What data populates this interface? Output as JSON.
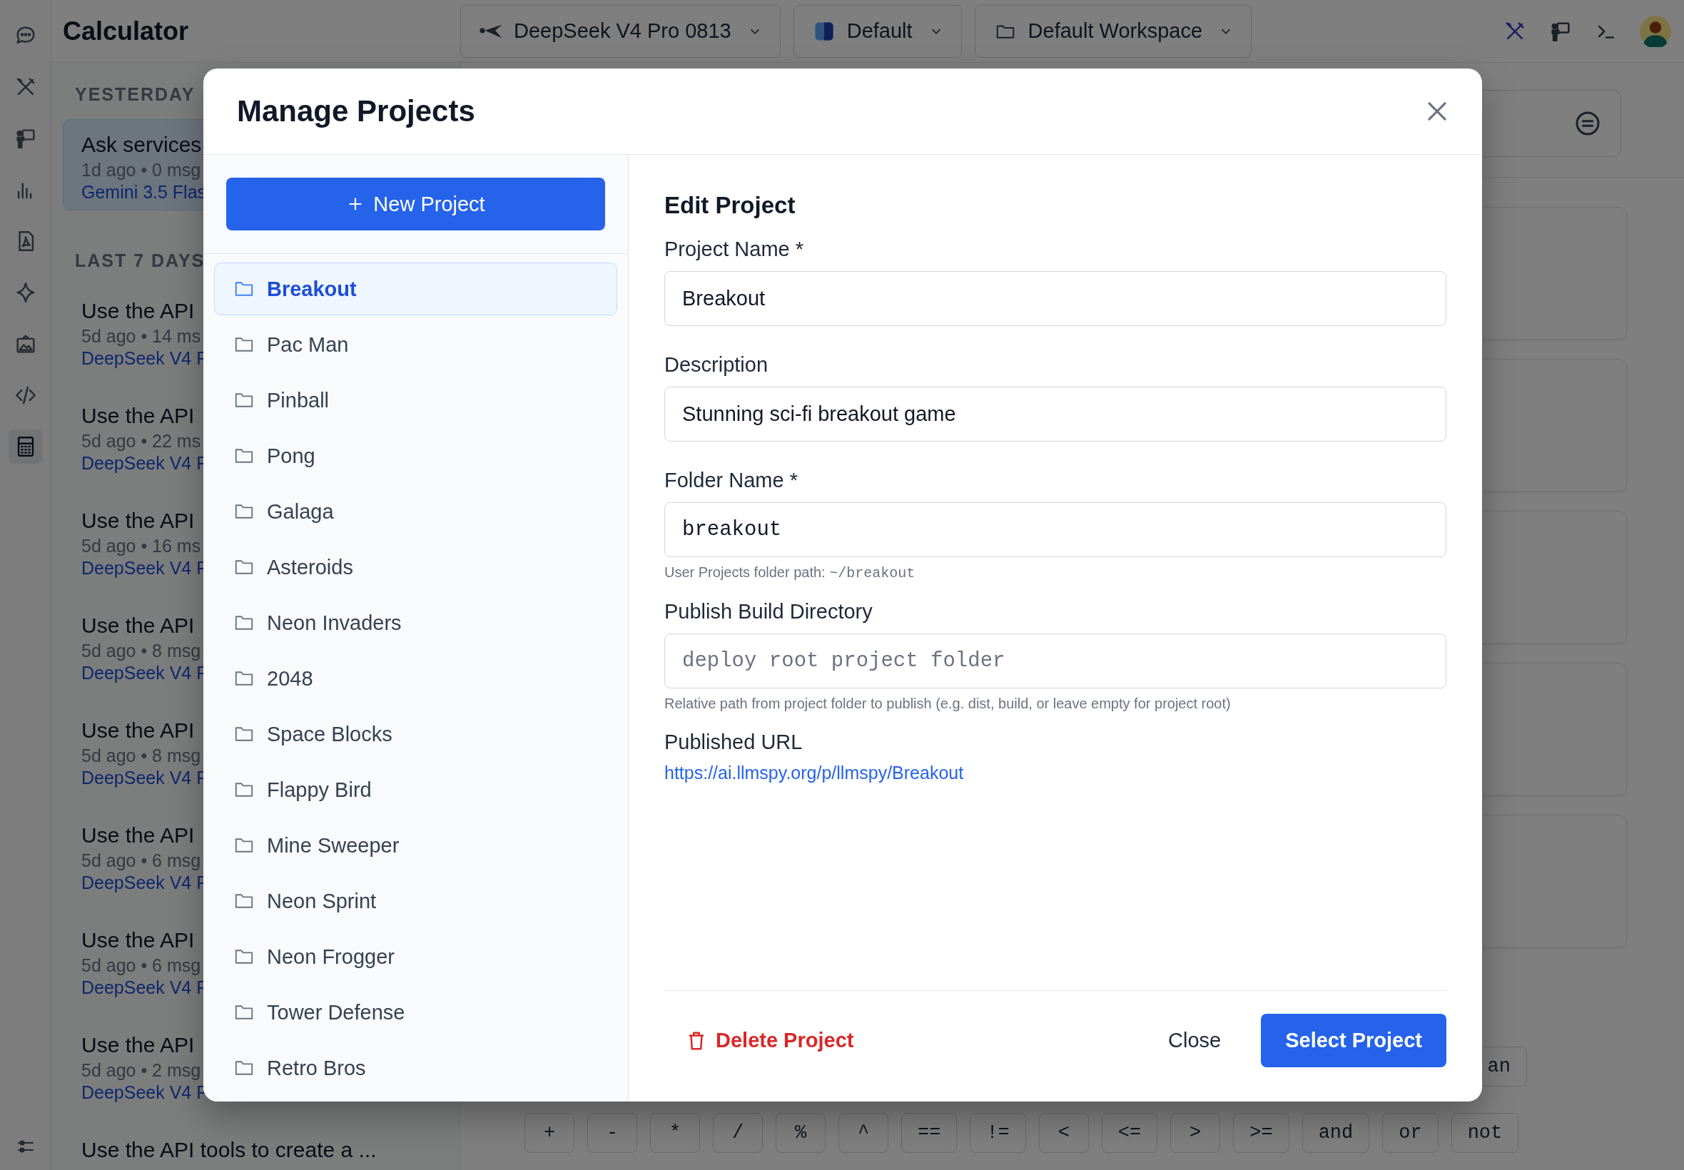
{
  "app": {
    "title": "Calculator"
  },
  "toolbar": {
    "model": "DeepSeek V4 Pro 0813",
    "profile": "Default",
    "workspace": "Default Workspace"
  },
  "rail": [
    {
      "kind": "chat",
      "selected": false
    },
    {
      "kind": "tools",
      "selected": false
    },
    {
      "kind": "presenter",
      "selected": false
    },
    {
      "kind": "chart",
      "selected": false
    },
    {
      "kind": "pdf",
      "selected": false
    },
    {
      "kind": "sparkle",
      "selected": false
    },
    {
      "kind": "image",
      "selected": false
    },
    {
      "kind": "code",
      "selected": false
    },
    {
      "kind": "calculator",
      "selected": true
    }
  ],
  "history": [
    {
      "heading": "YESTERDAY",
      "items": [
        {
          "title": "Ask services",
          "meta": "1d ago • 0 msg",
          "model": "Gemini 3.5 Flas",
          "selected": true
        }
      ]
    },
    {
      "heading": "LAST 7 DAYS",
      "items": [
        {
          "title": "Use the API",
          "meta": "5d ago • 14 ms",
          "model": "DeepSeek V4 F",
          "selected": false
        },
        {
          "title": "Use the API",
          "meta": "5d ago • 22 ms",
          "model": "DeepSeek V4 F",
          "selected": false
        },
        {
          "title": "Use the API",
          "meta": "5d ago • 16 ms",
          "model": "DeepSeek V4 F",
          "selected": false
        },
        {
          "title": "Use the API",
          "meta": "5d ago • 8 msg",
          "model": "DeepSeek V4 F",
          "selected": false
        },
        {
          "title": "Use the API",
          "meta": "5d ago • 8 msg",
          "model": "DeepSeek V4 F",
          "selected": false
        },
        {
          "title": "Use the API",
          "meta": "5d ago • 6 msg",
          "model": "DeepSeek V4 F",
          "selected": false
        },
        {
          "title": "Use the API",
          "meta": "5d ago • 6 msg",
          "model": "DeepSeek V4 F",
          "selected": false
        },
        {
          "title": "Use the API",
          "meta": "5d ago • 2 msg",
          "model": "DeepSeek V4 F",
          "selected": false
        },
        {
          "title": "Use the API tools to create a ...",
          "selected": false
        }
      ]
    }
  ],
  "partial_key": "an",
  "operators": [
    "+",
    "-",
    "*",
    "/",
    "%",
    "^",
    "==",
    "!=",
    "<",
    "<=",
    ">",
    ">=",
    "and",
    "or",
    "not"
  ],
  "modal": {
    "title": "Manage Projects",
    "new_project_button": "New Project",
    "projects": [
      {
        "name": "Breakout",
        "selected": true
      },
      {
        "name": "Pac Man",
        "selected": false
      },
      {
        "name": "Pinball",
        "selected": false
      },
      {
        "name": "Pong",
        "selected": false
      },
      {
        "name": "Galaga",
        "selected": false
      },
      {
        "name": "Asteroids",
        "selected": false
      },
      {
        "name": "Neon Invaders",
        "selected": false
      },
      {
        "name": "2048",
        "selected": false
      },
      {
        "name": "Space Blocks",
        "selected": false
      },
      {
        "name": "Flappy Bird",
        "selected": false
      },
      {
        "name": "Mine Sweeper",
        "selected": false
      },
      {
        "name": "Neon Sprint",
        "selected": false
      },
      {
        "name": "Neon Frogger",
        "selected": false
      },
      {
        "name": "Tower Defense",
        "selected": false
      },
      {
        "name": "Retro Bros",
        "selected": false
      }
    ],
    "form": {
      "heading": "Edit Project",
      "fields": [
        {
          "label": "Project Name *",
          "value": "Breakout",
          "mono": false
        },
        {
          "label": "Description",
          "value": "Stunning sci-fi breakout game",
          "mono": false
        },
        {
          "label": "Folder Name *",
          "value": "breakout",
          "mono": true,
          "hint": "User Projects folder path: ",
          "hint_path": "~/breakout"
        },
        {
          "label": "Publish Build Directory",
          "placeholder": "deploy root project folder",
          "mono": true,
          "hint": "Relative path from project folder to publish (e.g. dist, build, or leave empty for project root)"
        }
      ],
      "url_label": "Published URL",
      "url": "https://ai.llmspy.org/p/llmspy/Breakout"
    },
    "delete_button": "Delete Project",
    "close_button": "Close",
    "select_button": "Select Project"
  }
}
